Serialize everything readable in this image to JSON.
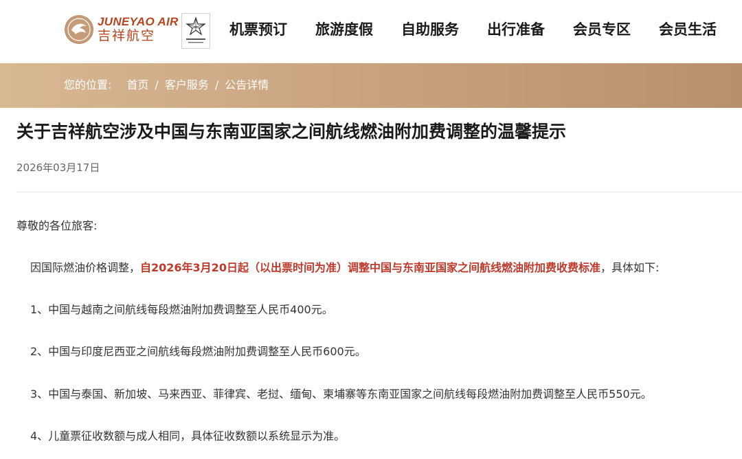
{
  "brand": {
    "name_en": "JUNEYAO AIR",
    "name_cn": "吉祥航空"
  },
  "nav": {
    "items": [
      "机票预订",
      "旅游度假",
      "自助服务",
      "出行准备",
      "会员专区",
      "会员生活"
    ]
  },
  "breadcrumb": {
    "label": "您的位置:",
    "items": [
      "首页",
      "客户服务",
      "公告详情"
    ],
    "separator": "/"
  },
  "article": {
    "title": "关于吉祥航空涉及中国与东南亚国家之间航线燃油附加费调整的温馨提示",
    "date": "2026年03月17日",
    "greeting": "尊敬的各位旅客:",
    "intro_prefix": "因国际燃油价格调整，",
    "intro_highlight": "自2026年3月20日起（以出票时间为准）调整中国与东南亚国家之间航线燃油附加费收费标准",
    "intro_suffix": "，具体如下:",
    "items": [
      "1、中国与越南之间航线每段燃油附加费调整至人民币400元。",
      "2、中国与印度尼西亚之间航线每段燃油附加费调整至人民币600元。",
      "3、中国与泰国、新加坡、马来西亚、菲律宾、老挝、缅甸、柬埔寨等东南亚国家之间航线每段燃油附加费调整至人民币550元。",
      "4、儿童票征收数额与成人相同，具体征收数额以系统显示为准。"
    ]
  },
  "colors": {
    "brand_accent": "#b5451c",
    "band_start": "#d8b893",
    "band_end": "#b8906d",
    "highlight": "#c0392b"
  }
}
